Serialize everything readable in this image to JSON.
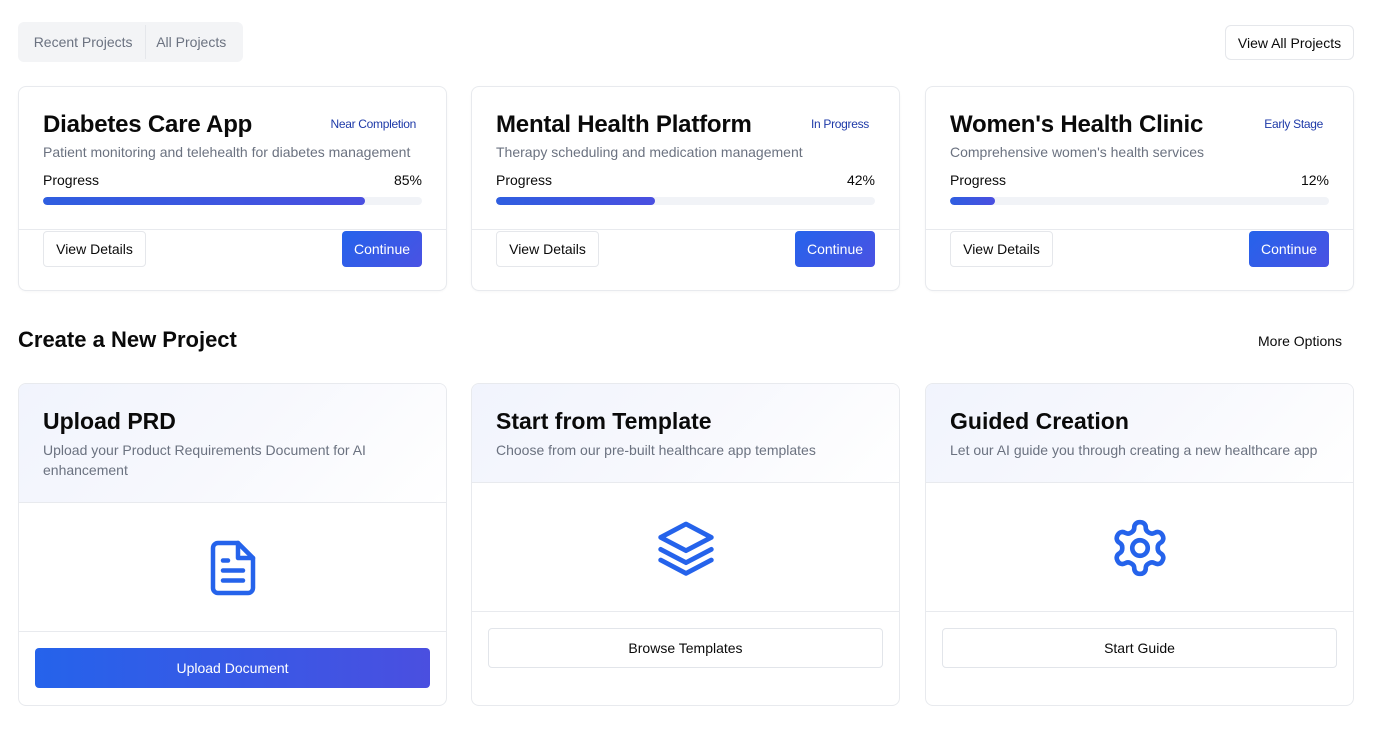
{
  "tabs": [
    {
      "label": "Recent Projects"
    },
    {
      "label": "All Projects"
    }
  ],
  "view_all_label": "View All Projects",
  "projects": [
    {
      "title": "Diabetes Care App",
      "status": "Near Completion",
      "description": "Patient monitoring and telehealth for diabetes management",
      "progress_label": "Progress",
      "progress_text": "85%",
      "progress": 85,
      "details_label": "View Details",
      "continue_label": "Continue"
    },
    {
      "title": "Mental Health Platform",
      "status": "In Progress",
      "description": "Therapy scheduling and medication management",
      "progress_label": "Progress",
      "progress_text": "42%",
      "progress": 42,
      "details_label": "View Details",
      "continue_label": "Continue"
    },
    {
      "title": "Women's Health Clinic",
      "status": "Early Stage",
      "description": "Comprehensive women's health services",
      "progress_label": "Progress",
      "progress_text": "12%",
      "progress": 12,
      "details_label": "View Details",
      "continue_label": "Continue"
    }
  ],
  "create_section": {
    "title": "Create a New Project",
    "more_options_label": "More Options",
    "cards": [
      {
        "title": "Upload PRD",
        "description": "Upload your Product Requirements Document for AI enhancement",
        "icon": "document-icon",
        "action_label": "Upload Document"
      },
      {
        "title": "Start from Template",
        "description": "Choose from our pre-built healthcare app templates",
        "icon": "layers-icon",
        "action_label": "Browse Templates"
      },
      {
        "title": "Guided Creation",
        "description": "Let our AI guide you through creating a new healthcare app",
        "icon": "gear-icon",
        "action_label": "Start Guide"
      }
    ]
  },
  "colors": {
    "accent": "#2563eb",
    "accent_end": "#4a4fe0",
    "badge_text": "#1e3aa8",
    "muted_text": "#6b7280",
    "border": "#e8eaee"
  }
}
